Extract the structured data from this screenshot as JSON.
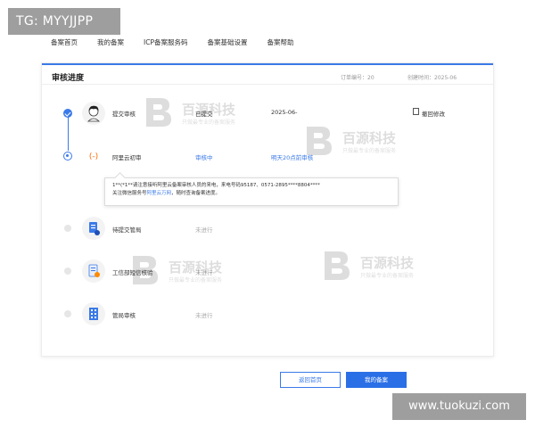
{
  "overlay_tag": "TG: MYYJJPP",
  "site_tag": "www.tuokuzi.com",
  "nav": {
    "items": [
      "备案首页",
      "我的备案",
      "ICP备案服务码",
      "备案基础设置",
      "备案帮助"
    ]
  },
  "card": {
    "title": "审核进度",
    "order_id": "订单编号：20",
    "created": "创建时间：2025-06"
  },
  "steps": [
    {
      "name": "提交审核",
      "status": "已提交",
      "time": "2025-06-",
      "action": "撤回修改",
      "state": "done"
    },
    {
      "name": "阿里云初审",
      "status": "审核中",
      "note": "明天20点前审核",
      "state": "active"
    },
    {
      "name": "待提交管局",
      "status": "未进行",
      "state": "todo"
    },
    {
      "name": "工信部短信核验",
      "status": "未进行",
      "state": "todo"
    },
    {
      "name": "管局审核",
      "status": "未进行",
      "state": "todo"
    }
  ],
  "tooltip": {
    "line1": "1**(*1**请注意接听阿里云备案审核人员的来电，来电号码95187、0571-2895****8804****",
    "line2_prefix": "关注微信服务号",
    "line2_link": "阿里云万网",
    "line2_suffix": "，随时查询备案进度。"
  },
  "buttons": {
    "home": "返回首页",
    "my": "我的备案"
  },
  "watermark": {
    "title": "百源科技",
    "subtitle": "只做最专业的备案服务"
  },
  "colors": {
    "accent": "#3b7ae8",
    "primary_button": "#2a6fe6",
    "overlay_grey": "#9e9e9e"
  }
}
